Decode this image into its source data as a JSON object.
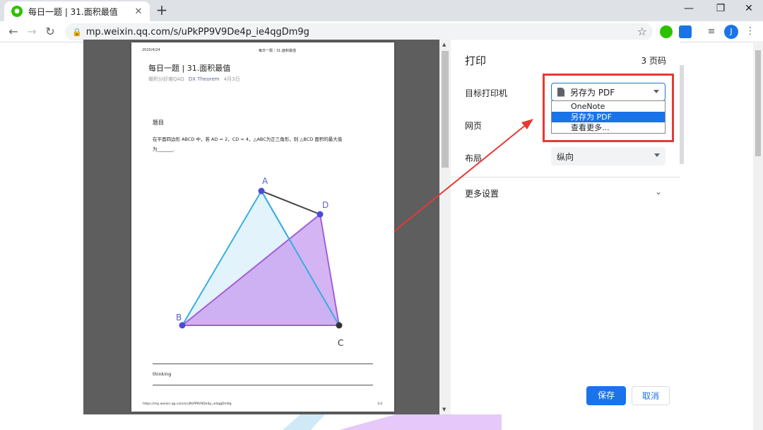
{
  "browser": {
    "tab_title": "每日一题 | 31.面积最值",
    "tab_close": "✕",
    "new_tab": "+",
    "url": "mp.weixin.qq.com/s/uPkPP9V9De4p_ie4qgDm9g",
    "avatar_letter": "J",
    "minimize": "—",
    "restore": "❐",
    "close_window": "✕"
  },
  "preview": {
    "date": "2020/4/24",
    "running_title": "每日一题｜31.面积最值",
    "title": "每日一题 | 31.面积最值",
    "author": "微积分好难QAQ",
    "account": "DX Theorem",
    "publish_date": "4月3日",
    "section": "题目",
    "problem_line1": "在平面四边形 ABCD 中，若 AD = 2，CD = 4，△ABC为正三角形，则 △BCD 面积的最大值",
    "problem_line2": "为_______.",
    "points": {
      "a": "A",
      "b": "B",
      "c": "C",
      "d": "D"
    },
    "thinking": "thinking",
    "footer_url": "https://mp.weixin.qq.com/s/uPkPP9V9De4p_ie4qgDm9g",
    "page_num": "1/3"
  },
  "print": {
    "heading": "打印",
    "page_count": "3 页码",
    "destination_label": "目标打印机",
    "destination_value": "另存为 PDF",
    "destination_options": [
      "OneNote",
      "另存为 PDF",
      "查看更多..."
    ],
    "pages_label": "网页",
    "layout_label": "布局",
    "layout_value": "纵向",
    "more_settings": "更多设置",
    "save_button": "保存",
    "cancel_button": "取消"
  },
  "colors": {
    "annotation": "#e53935",
    "accent": "#1a73e8",
    "triangle_abc": "#3aaee0",
    "triangle_bcd_fill": "#d9a9f5"
  }
}
